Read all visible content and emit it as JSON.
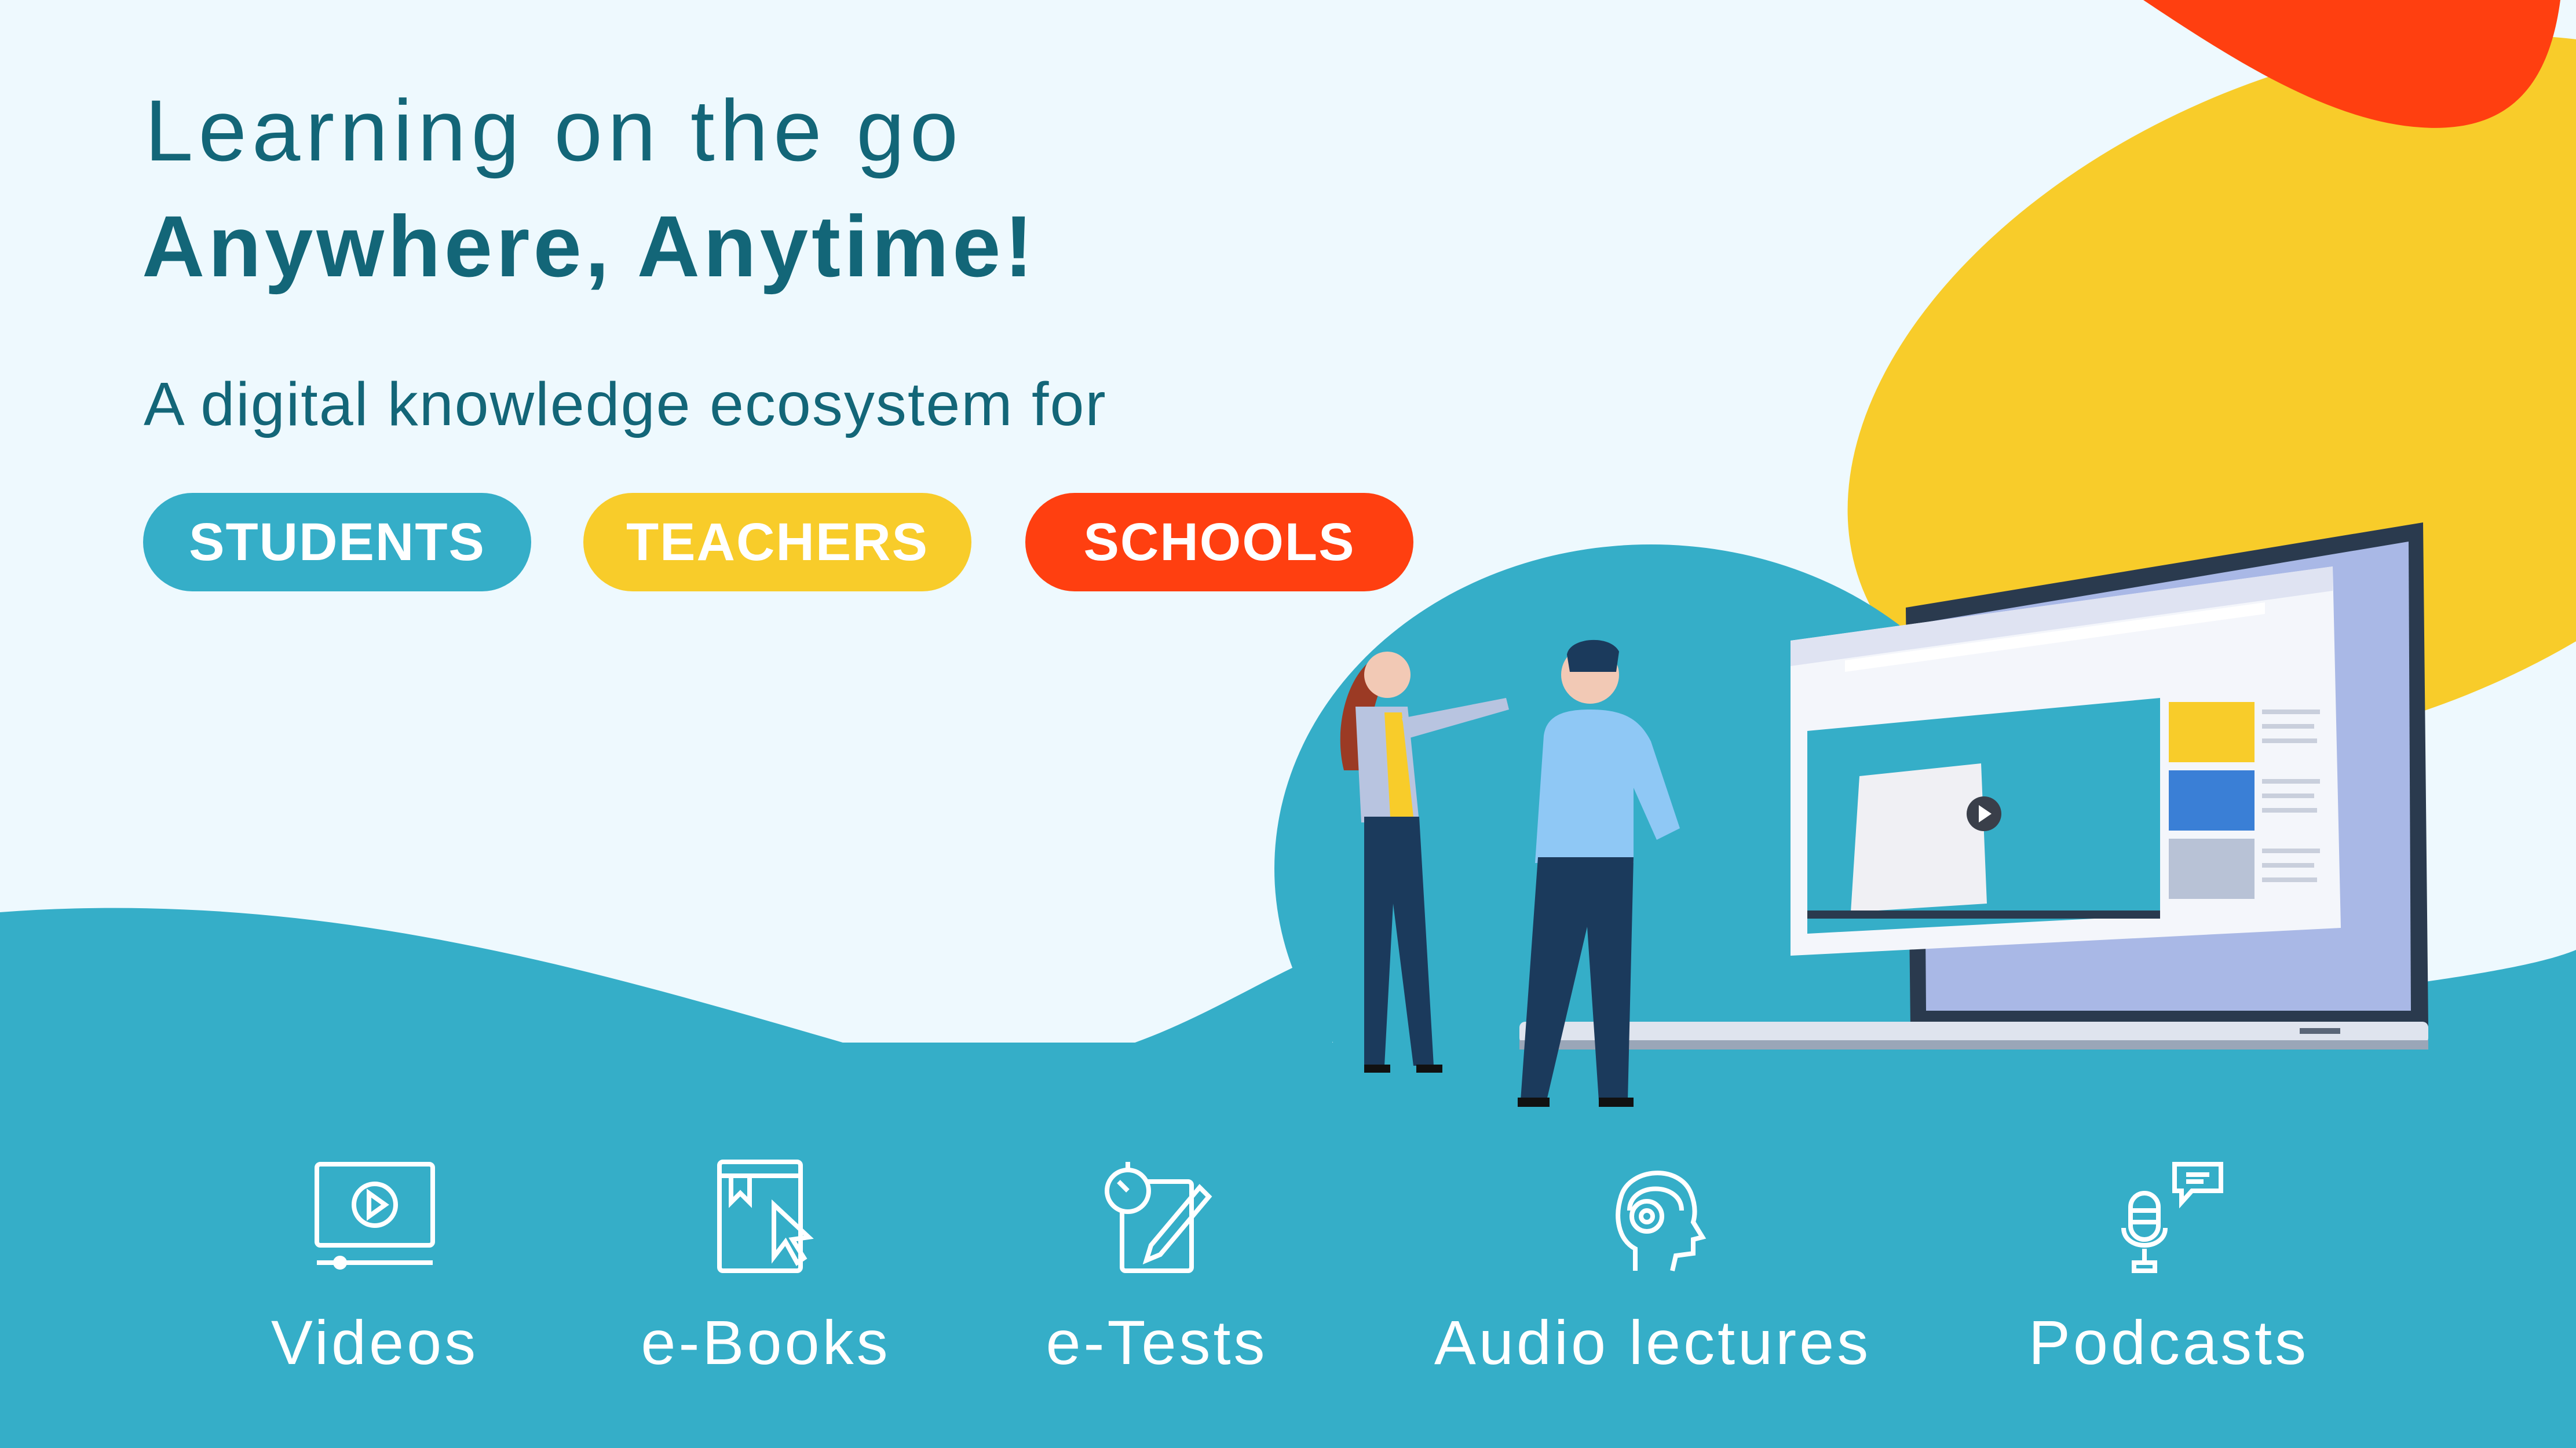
{
  "hero": {
    "line1": "Learning on the go",
    "line2": "Anywhere, Anytime!",
    "subtitle": "A digital knowledge ecosystem for"
  },
  "audiences": [
    {
      "label": "STUDENTS",
      "color": "#35aec8"
    },
    {
      "label": "TEACHERS",
      "color": "#f8cc2a"
    },
    {
      "label": "SCHOOLS",
      "color": "#ff3f10"
    }
  ],
  "features": [
    {
      "label": "Videos",
      "icon": "video-player-icon"
    },
    {
      "label": "e-Books",
      "icon": "ebook-icon"
    },
    {
      "label": "e-Tests",
      "icon": "test-stopwatch-icon"
    },
    {
      "label": "Audio lectures",
      "icon": "headphones-head-icon"
    },
    {
      "label": "Podcasts",
      "icon": "microphone-chat-icon"
    }
  ],
  "colors": {
    "teal": "#35aec8",
    "yellow": "#f8cc2a",
    "orange": "#ff3f10",
    "navy": "#136678",
    "background": "#eef9fe"
  }
}
